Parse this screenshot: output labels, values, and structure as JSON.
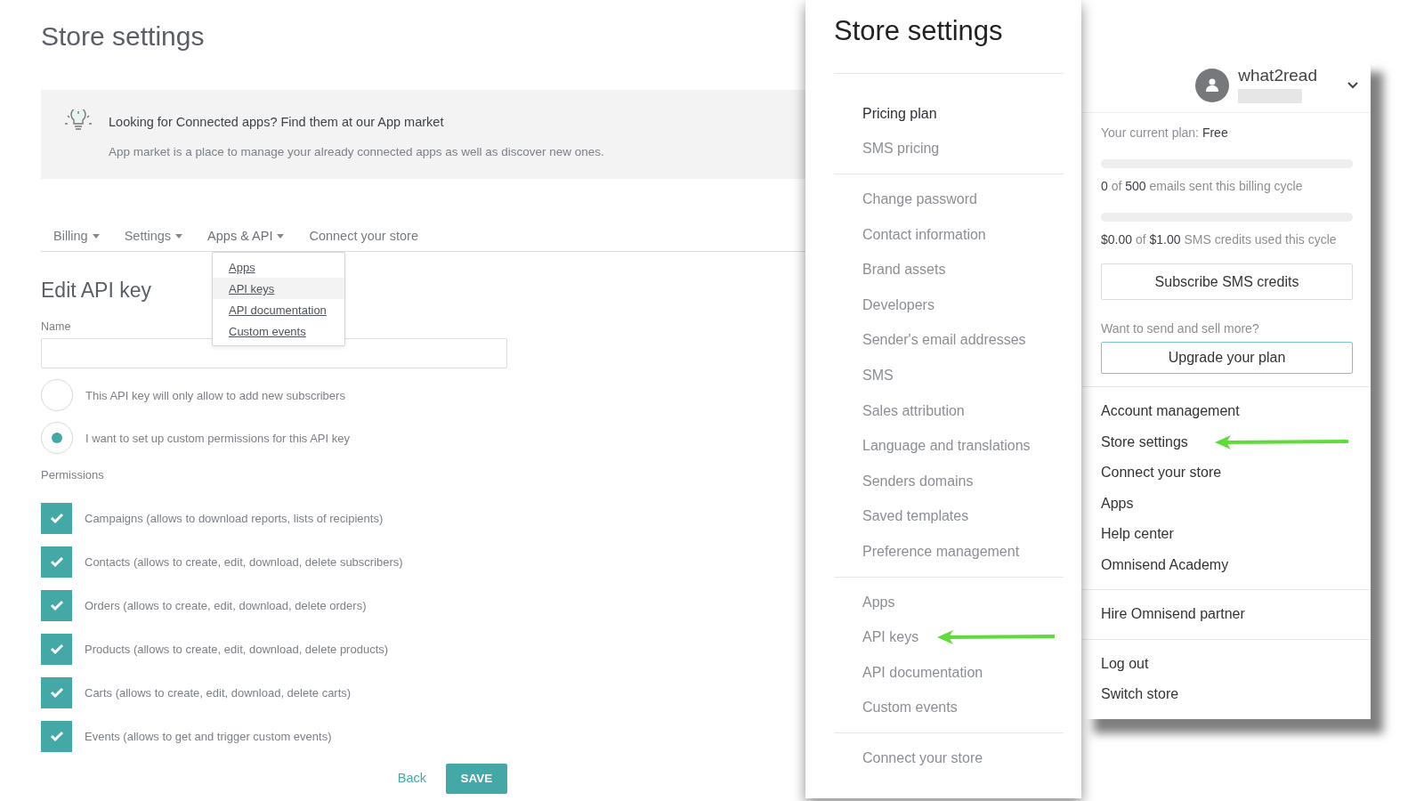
{
  "page": {
    "title": "Store settings",
    "banner": {
      "title": "Looking for Connected apps? Find them at our App market",
      "text": "App market is a place to manage your already connected apps as well as discover new ones."
    },
    "tabs": [
      {
        "label": "Billing",
        "caret": true,
        "selected": false
      },
      {
        "label": "Settings",
        "caret": true,
        "selected": false
      },
      {
        "label": "Apps & API",
        "caret": true,
        "selected": true
      },
      {
        "label": "Connect your store",
        "caret": false,
        "selected": false
      }
    ],
    "tab_menu": [
      {
        "label": "Apps",
        "selected": false
      },
      {
        "label": "API keys",
        "selected": true
      },
      {
        "label": "API documentation",
        "selected": false
      },
      {
        "label": "Custom events",
        "selected": false
      }
    ],
    "form": {
      "heading": "Edit API key",
      "name_label": "Name",
      "options": [
        {
          "label": "This API key will only allow to add new subscribers",
          "selected": false
        },
        {
          "label": "I want to set up custom permissions for this API key",
          "selected": true
        }
      ],
      "permissions_label": "Permissions",
      "permissions": [
        {
          "label": "Campaigns (allows to download reports, lists of recipients)",
          "checked": true
        },
        {
          "label": "Contacts (allows to create, edit, download, delete subscribers)",
          "checked": true
        },
        {
          "label": "Orders (allows to create, edit, download, delete orders)",
          "checked": true
        },
        {
          "label": "Products (allows to create, edit, download, delete products)",
          "checked": true
        },
        {
          "label": "Carts (allows to create, edit, download, delete carts)",
          "checked": true
        },
        {
          "label": "Events (allows to get and trigger custom events)",
          "checked": true
        }
      ],
      "back": "Back",
      "save": "SAVE"
    }
  },
  "settings_menu": {
    "title": "Store settings",
    "groups": [
      [
        {
          "label": "Pricing plan",
          "selected": true
        },
        {
          "label": "SMS pricing",
          "selected": false
        }
      ],
      [
        {
          "label": "Change password",
          "selected": false
        },
        {
          "label": "Contact information",
          "selected": false
        },
        {
          "label": "Brand assets",
          "selected": false
        },
        {
          "label": "Developers",
          "selected": false
        },
        {
          "label": "Sender's email addresses",
          "selected": false
        },
        {
          "label": "SMS",
          "selected": false
        },
        {
          "label": "Sales attribution",
          "selected": false
        },
        {
          "label": "Language and translations",
          "selected": false
        },
        {
          "label": "Senders domains",
          "selected": false
        },
        {
          "label": "Saved templates",
          "selected": false
        },
        {
          "label": "Preference management",
          "selected": false
        }
      ],
      [
        {
          "label": "Apps",
          "selected": false
        },
        {
          "label": "API keys",
          "selected": false,
          "arrow": true
        },
        {
          "label": "API documentation",
          "selected": false
        },
        {
          "label": "Custom events",
          "selected": false
        }
      ],
      [
        {
          "label": "Connect your store",
          "selected": false
        }
      ]
    ]
  },
  "account_menu": {
    "username": "what2read",
    "plan": "Your current plan: **Free**",
    "usage": [
      {
        "text": "**0** of **500** emails sent this billing cycle",
        "level": 0
      },
      {
        "text": "**$0.00** of **$1.00** SMS credits used this cycle",
        "level": 0
      }
    ],
    "subscribe": "Subscribe SMS credits",
    "upsell": "Want to send and sell more?",
    "upgrade": "Upgrade your plan",
    "groups": [
      [
        {
          "label": "Account management"
        },
        {
          "label": "Store settings",
          "arrow": true
        },
        {
          "label": "Connect your store"
        },
        {
          "label": "Apps"
        },
        {
          "label": "Help center"
        },
        {
          "label": "Omnisend Academy"
        }
      ],
      [
        {
          "label": "Hire Omnisend partner"
        }
      ],
      [
        {
          "label": "Log out"
        },
        {
          "label": "Switch store"
        }
      ]
    ]
  }
}
